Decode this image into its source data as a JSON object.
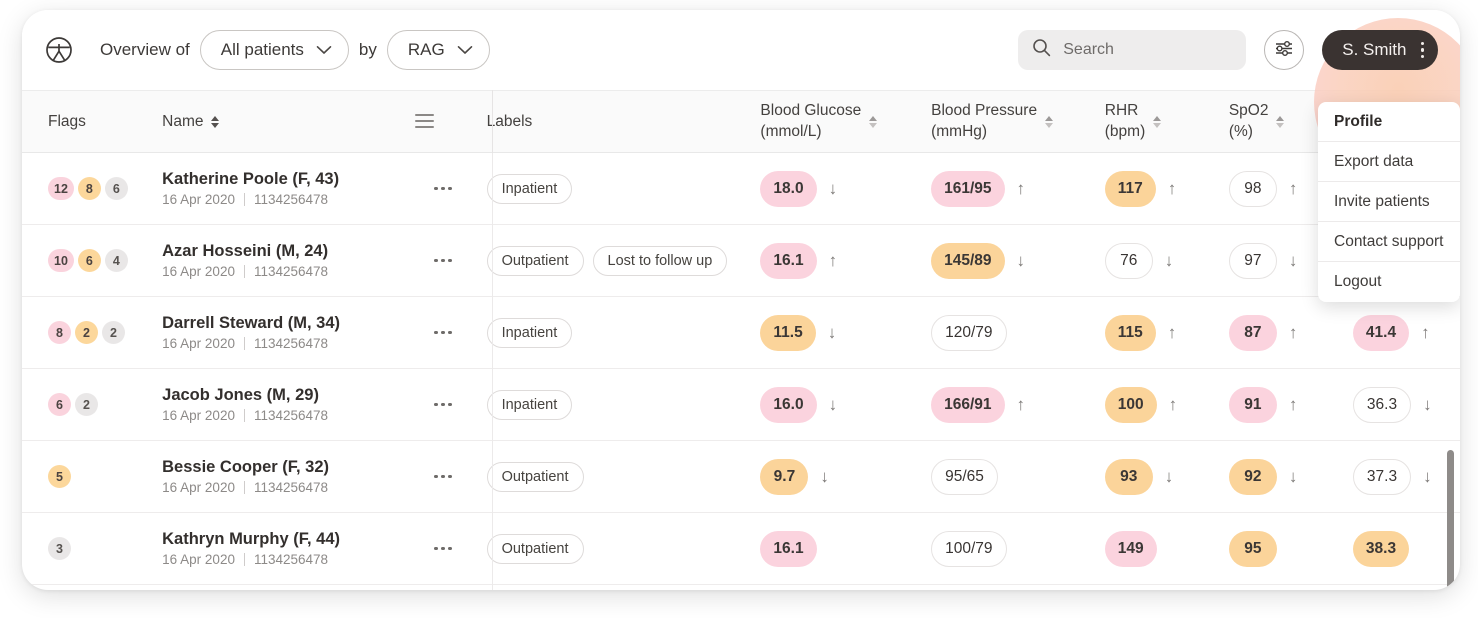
{
  "app": {
    "logo_icon": "clinic-figure-logo"
  },
  "header": {
    "overview_label": "Overview of",
    "scope_select": {
      "value": "All patients",
      "icon": "chevron-down-icon"
    },
    "by_label": "by",
    "grouping_select": {
      "value": "RAG",
      "icon": "chevron-down-icon"
    },
    "search": {
      "placeholder": "Search",
      "value": "",
      "icon": "search-icon"
    },
    "filter_button": {
      "icon": "sliders-filter-icon"
    },
    "user": {
      "name": "S. Smith",
      "menu_icon": "kebab-vertical-icon"
    }
  },
  "user_menu": {
    "items": [
      {
        "label": "Profile",
        "active": true
      },
      {
        "label": "Export data",
        "active": false
      },
      {
        "label": "Invite patients",
        "active": false
      },
      {
        "label": "Contact support",
        "active": false
      },
      {
        "label": "Logout",
        "active": false
      }
    ]
  },
  "table": {
    "columns": {
      "flags": "Flags",
      "name": "Name",
      "menu_icon": "hamburger-menu-icon",
      "labels": "Labels",
      "blood_glucose": {
        "title": "Blood Glucose",
        "unit": "(mmol/L)"
      },
      "blood_pressure": {
        "title": "Blood Pressure",
        "unit": "(mmHg)"
      },
      "rhr": {
        "title": "RHR",
        "unit": "(bpm)"
      },
      "spo2": {
        "title": "SpO2",
        "unit": "(%)"
      }
    },
    "rows": [
      {
        "flags": [
          {
            "value": "12",
            "tone": "red"
          },
          {
            "value": "8",
            "tone": "amber"
          },
          {
            "value": "6",
            "tone": "grey"
          }
        ],
        "name": "Katherine Poole (F, 43)",
        "date": "16 Apr 2020",
        "id": "1134256478",
        "labels": [
          "Inpatient"
        ],
        "metrics": [
          {
            "value": "18.0",
            "tone": "red",
            "trend": "↓"
          },
          {
            "value": "161/95",
            "tone": "red",
            "trend": "↑"
          },
          {
            "value": "117",
            "tone": "amber",
            "trend": "↑"
          },
          {
            "value": "98",
            "tone": "plain",
            "trend": "↑"
          },
          {
            "value": "",
            "tone": "hidden",
            "trend": ""
          }
        ]
      },
      {
        "flags": [
          {
            "value": "10",
            "tone": "red"
          },
          {
            "value": "6",
            "tone": "amber"
          },
          {
            "value": "4",
            "tone": "grey"
          }
        ],
        "name": "Azar Hosseini (M, 24)",
        "date": "16 Apr 2020",
        "id": "1134256478",
        "labels": [
          "Outpatient",
          "Lost to follow up"
        ],
        "metrics": [
          {
            "value": "16.1",
            "tone": "red",
            "trend": "↑"
          },
          {
            "value": "145/89",
            "tone": "amber",
            "trend": "↓"
          },
          {
            "value": "76",
            "tone": "plain",
            "trend": "↓"
          },
          {
            "value": "97",
            "tone": "plain",
            "trend": "↓"
          },
          {
            "value": "",
            "tone": "hidden",
            "trend": ""
          }
        ]
      },
      {
        "flags": [
          {
            "value": "8",
            "tone": "red"
          },
          {
            "value": "2",
            "tone": "amber"
          },
          {
            "value": "2",
            "tone": "grey"
          }
        ],
        "name": "Darrell Steward (M, 34)",
        "date": "16 Apr 2020",
        "id": "1134256478",
        "labels": [
          "Inpatient"
        ],
        "metrics": [
          {
            "value": "11.5",
            "tone": "amber",
            "trend": "↓"
          },
          {
            "value": "120/79",
            "tone": "plain",
            "trend": ""
          },
          {
            "value": "115",
            "tone": "amber",
            "trend": "↑"
          },
          {
            "value": "87",
            "tone": "red",
            "trend": "↑"
          },
          {
            "value": "41.4",
            "tone": "red",
            "trend": "↑"
          }
        ]
      },
      {
        "flags": [
          {
            "value": "6",
            "tone": "red"
          },
          {
            "value": "2",
            "tone": "grey"
          }
        ],
        "name": "Jacob Jones (M, 29)",
        "date": "16 Apr 2020",
        "id": "1134256478",
        "labels": [
          "Inpatient"
        ],
        "metrics": [
          {
            "value": "16.0",
            "tone": "red",
            "trend": "↓"
          },
          {
            "value": "166/91",
            "tone": "red",
            "trend": "↑"
          },
          {
            "value": "100",
            "tone": "amber",
            "trend": "↑"
          },
          {
            "value": "91",
            "tone": "red",
            "trend": "↑"
          },
          {
            "value": "36.3",
            "tone": "plain",
            "trend": "↓"
          }
        ]
      },
      {
        "flags": [
          {
            "value": "5",
            "tone": "amber"
          }
        ],
        "name": "Bessie Cooper (F, 32)",
        "date": "16 Apr 2020",
        "id": "1134256478",
        "labels": [
          "Outpatient"
        ],
        "metrics": [
          {
            "value": "9.7",
            "tone": "amber",
            "trend": "↓"
          },
          {
            "value": "95/65",
            "tone": "plain",
            "trend": ""
          },
          {
            "value": "93",
            "tone": "amber",
            "trend": "↓"
          },
          {
            "value": "92",
            "tone": "amber",
            "trend": "↓"
          },
          {
            "value": "37.3",
            "tone": "plain",
            "trend": "↓"
          }
        ]
      },
      {
        "flags": [
          {
            "value": "3",
            "tone": "grey"
          }
        ],
        "name": "Kathryn Murphy (F, 44)",
        "date": "16 Apr 2020",
        "id": "1134256478",
        "labels": [
          "Outpatient"
        ],
        "metrics": [
          {
            "value": "16.1",
            "tone": "red",
            "trend": ""
          },
          {
            "value": "100/79",
            "tone": "plain",
            "trend": ""
          },
          {
            "value": "149",
            "tone": "red",
            "trend": ""
          },
          {
            "value": "95",
            "tone": "amber",
            "trend": ""
          },
          {
            "value": "38.3",
            "tone": "amber",
            "trend": ""
          }
        ]
      }
    ]
  },
  "colors": {
    "red": "#fbd3de",
    "amber": "#fbd49a",
    "grey": "#e9e7e7",
    "user_button": "#3a3331",
    "highlight": "#facdb2"
  }
}
